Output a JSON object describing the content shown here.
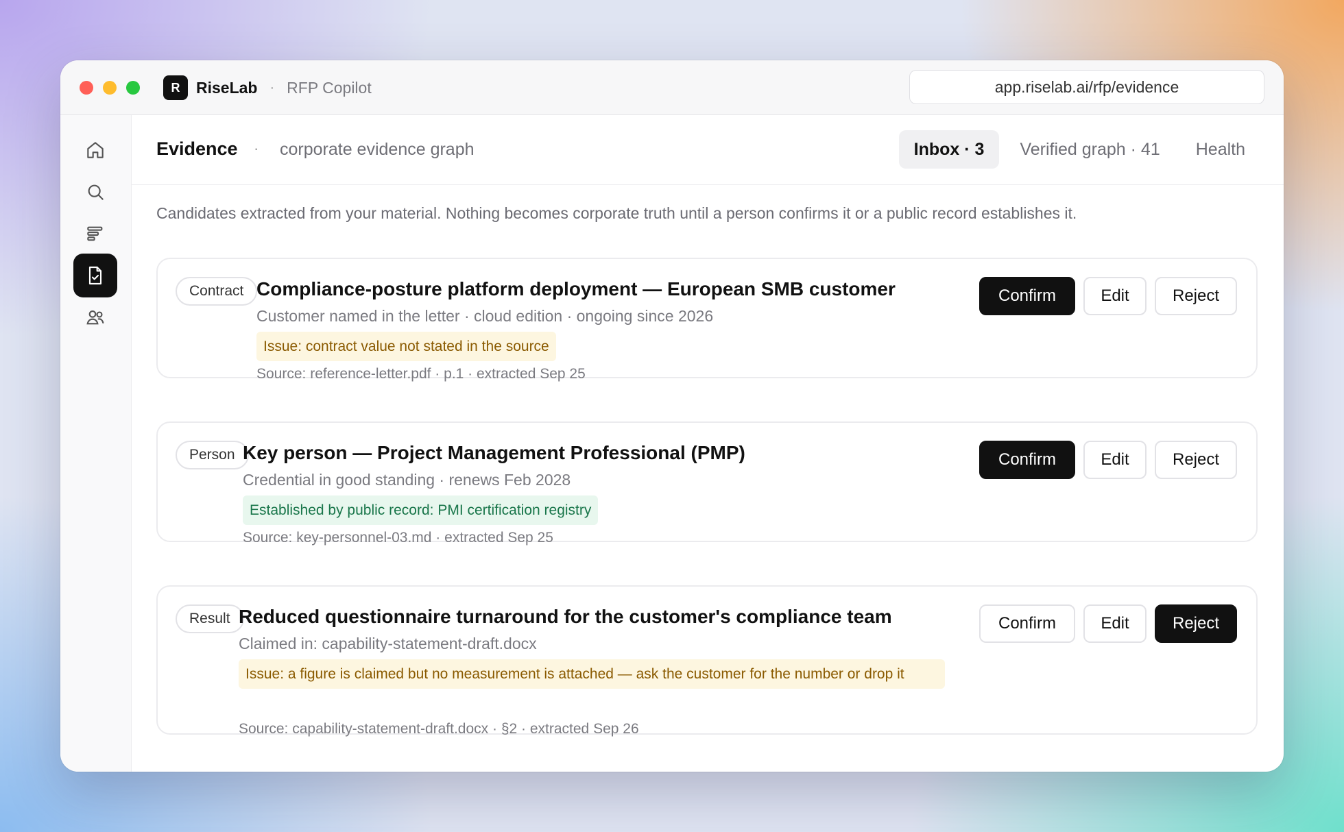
{
  "window": {
    "brand_initial": "R",
    "brand_name": "RiseLab",
    "separator": "·",
    "product": "RFP Copilot",
    "url": "app.riselab.ai/rfp/evidence"
  },
  "sidebar": {
    "items": [
      {
        "icon": "home-icon",
        "active": false
      },
      {
        "icon": "search-icon",
        "active": false
      },
      {
        "icon": "list-icon",
        "active": false
      },
      {
        "icon": "document-check-icon",
        "active": true
      },
      {
        "icon": "users-icon",
        "active": false
      }
    ]
  },
  "header": {
    "title": "Evidence",
    "separator": "·",
    "subtitle": "corporate evidence graph",
    "tabs": [
      {
        "label": "Inbox · 3",
        "active": true
      },
      {
        "label": "Verified graph · 41",
        "active": false
      },
      {
        "label": "Health",
        "active": false
      }
    ]
  },
  "intro": "Candidates extracted from your material. Nothing becomes corporate truth until a person confirms it or a public record establishes it.",
  "cards": [
    {
      "tag": "Contract",
      "title": "Compliance-posture platform deployment — European SMB customer",
      "description": "Customer named in the letter · cloud edition · ongoing since 2026",
      "note": "Issue: contract value not stated in the source",
      "note_type": "warn",
      "source": "Source: reference-letter.pdf · p.1 · extracted Sep 25",
      "actions": {
        "confirm": "Confirm",
        "edit": "Edit",
        "reject": "Reject",
        "primary": "confirm"
      }
    },
    {
      "tag": "Person",
      "title": "Key person — Project Management Professional (PMP)",
      "description": "Credential in good standing · renews Feb 2028",
      "note": "Established by public record: PMI certification registry",
      "note_type": "ok",
      "source": "Source: key-personnel-03.md · extracted Sep 25",
      "actions": {
        "confirm": "Confirm",
        "edit": "Edit",
        "reject": "Reject",
        "primary": "confirm"
      }
    },
    {
      "tag": "Result",
      "title": "Reduced questionnaire turnaround for the customer's compliance team",
      "description": "Claimed in: capability-statement-draft.docx",
      "note": "Issue: a figure is claimed but no measurement is attached — ask the customer for the number or drop it",
      "note_type": "warn",
      "source": "Source: capability-statement-draft.docx · §2 · extracted Sep 26",
      "actions": {
        "confirm": "Confirm",
        "edit": "Edit",
        "reject": "Reject",
        "primary": "reject"
      }
    }
  ]
}
